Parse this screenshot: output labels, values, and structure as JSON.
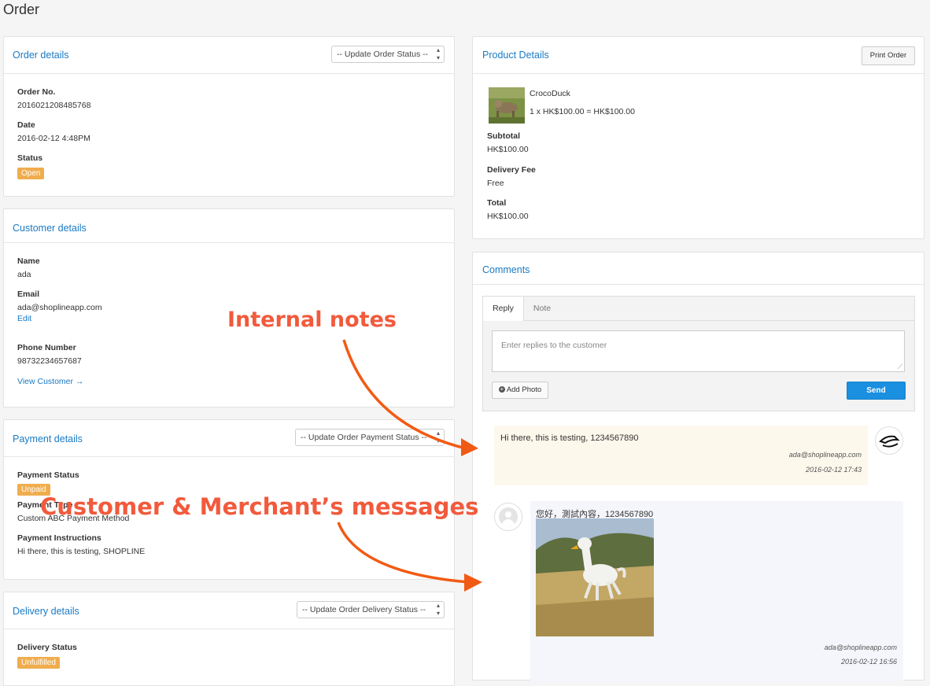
{
  "page": {
    "title": "Order"
  },
  "order": {
    "title": "Order details",
    "status_select": "-- Update Order Status --",
    "order_no_label": "Order No.",
    "order_no": "2016021208485768",
    "date_label": "Date",
    "date": "2016-02-12 4:48PM",
    "status_label": "Status",
    "status": "Open"
  },
  "customer": {
    "title": "Customer details",
    "name_label": "Name",
    "name": "ada",
    "email_label": "Email",
    "email": "ada@shoplineapp.com",
    "edit": "Edit",
    "phone_label": "Phone Number",
    "phone": "98732234657687",
    "view_link": "View Customer →"
  },
  "payment": {
    "title": "Payment details",
    "status_select": "-- Update Order Payment Status --",
    "status_label": "Payment Status",
    "status": "Unpaid",
    "type_label": "Payment Type",
    "type": "Custom ABC Payment Method",
    "instructions_label": "Payment Instructions",
    "instructions": "Hi there, this is testing, SHOPLINE"
  },
  "delivery": {
    "title": "Delivery details",
    "status_select": "-- Update Order Delivery Status --",
    "status_label": "Delivery Status",
    "status": "Unfulfilled"
  },
  "product": {
    "title": "Product Details",
    "print_button": "Print Order",
    "name": "CrocoDuck",
    "line": "1 x HK$100.00 = HK$100.00",
    "subtotal_label": "Subtotal",
    "subtotal": "HK$100.00",
    "delivery_fee_label": "Delivery Fee",
    "delivery_fee": "Free",
    "total_label": "Total",
    "total": "HK$100.00"
  },
  "comments": {
    "title": "Comments",
    "tabs": [
      "Reply",
      "Note"
    ],
    "placeholder": "Enter replies to the customer",
    "add_photo": "Add Photo",
    "send": "Send",
    "messages": [
      {
        "text": "Hi there, this is testing, 1234567890",
        "author": "ada@shoplineapp.com",
        "time": "2016-02-12 17:43"
      },
      {
        "text": "您好，測試內容，1234567890",
        "author": "ada@shoplineapp.com",
        "time": "2016-02-12 16:56"
      }
    ]
  },
  "annotations": {
    "internal": "Internal notes",
    "messages": "Customer & Merchant’s messages"
  },
  "colors": {
    "accent": "#1a7ac4",
    "badge": "#f0ad4e",
    "send": "#1b8fe0",
    "note_bg": "#fdf8ec",
    "msg_bg": "#f4f6fb",
    "annotation": "#f15a3c"
  }
}
